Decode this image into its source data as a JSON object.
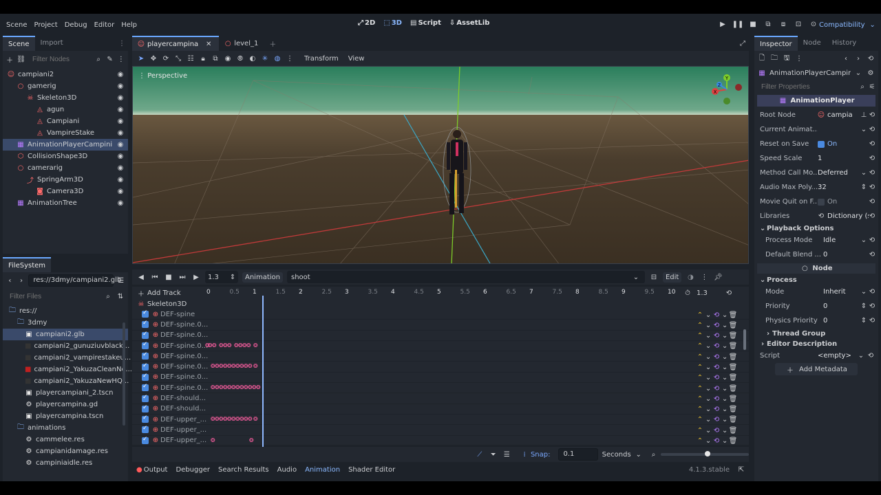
{
  "topbar": {
    "menus": [
      "Scene",
      "Project",
      "Debug",
      "Editor",
      "Help"
    ],
    "modes": [
      {
        "label": "2D",
        "active": false
      },
      {
        "label": "3D",
        "active": true
      },
      {
        "label": "Script",
        "active": false
      },
      {
        "label": "AssetLib",
        "active": false
      }
    ],
    "renderer": "Compatibility"
  },
  "scene_dock": {
    "tabs": [
      "Scene",
      "Import"
    ],
    "filter_placeholder": "Filter Nodes",
    "nodes": [
      {
        "label": "campiani2",
        "depth": 0,
        "icon": "person",
        "color": "#ff6a6a",
        "selected": false
      },
      {
        "label": "gamerig",
        "depth": 1,
        "icon": "circle",
        "color": "#ff6a6a",
        "selected": false
      },
      {
        "label": "Skeleton3D",
        "depth": 2,
        "icon": "bone",
        "color": "#ff6a6a",
        "selected": false
      },
      {
        "label": "agun",
        "depth": 3,
        "icon": "mesh",
        "color": "#ff6a6a",
        "selected": false
      },
      {
        "label": "Campiani",
        "depth": 3,
        "icon": "mesh",
        "color": "#ff6a6a",
        "selected": false
      },
      {
        "label": "VampireStake",
        "depth": 3,
        "icon": "mesh",
        "color": "#ff6a6a",
        "selected": false
      },
      {
        "label": "AnimationPlayerCampini",
        "depth": 1,
        "icon": "anim",
        "color": "#b77cff",
        "selected": true
      },
      {
        "label": "CollisionShape3D",
        "depth": 1,
        "icon": "shape",
        "color": "#ff6a6a",
        "selected": false
      },
      {
        "label": "camerarig",
        "depth": 1,
        "icon": "circle",
        "color": "#ff6a6a",
        "selected": false
      },
      {
        "label": "SpringArm3D",
        "depth": 2,
        "icon": "arm",
        "color": "#ff6a6a",
        "selected": false
      },
      {
        "label": "Camera3D",
        "depth": 3,
        "icon": "camera",
        "color": "#ff6a6a",
        "selected": false
      },
      {
        "label": "AnimationTree",
        "depth": 1,
        "icon": "anim",
        "color": "#b77cff",
        "selected": false
      }
    ]
  },
  "filesystem": {
    "title": "FileSystem",
    "path": "res://3dmy/campiani2.glb",
    "filter_placeholder": "Filter Files",
    "items": [
      {
        "label": "res://",
        "depth": 0,
        "kind": "folder",
        "selected": false
      },
      {
        "label": "3dmy",
        "depth": 1,
        "kind": "folder",
        "selected": false
      },
      {
        "label": "campiani2.glb",
        "depth": 2,
        "kind": "scene",
        "selected": true
      },
      {
        "label": "campiani2_gunuziuvblack...",
        "depth": 2,
        "kind": "image-dark",
        "selected": false
      },
      {
        "label": "campiani2_vampirestakeu...",
        "depth": 2,
        "kind": "image-dark",
        "selected": false
      },
      {
        "label": "campiani2_YakuzaCleanNo...",
        "depth": 2,
        "kind": "image-red",
        "selected": false
      },
      {
        "label": "campiani2_YakuzaNewHQ...",
        "depth": 2,
        "kind": "image-dark",
        "selected": false
      },
      {
        "label": "playercampiani_2.tscn",
        "depth": 2,
        "kind": "scene",
        "selected": false
      },
      {
        "label": "playercampina.gd",
        "depth": 2,
        "kind": "gear",
        "selected": false
      },
      {
        "label": "playercampina.tscn",
        "depth": 2,
        "kind": "scene",
        "selected": false
      },
      {
        "label": "animations",
        "depth": 1,
        "kind": "folder",
        "selected": false
      },
      {
        "label": "cammelee.res",
        "depth": 2,
        "kind": "res",
        "selected": false
      },
      {
        "label": "campianidamage.res",
        "depth": 2,
        "kind": "res",
        "selected": false
      },
      {
        "label": "campiniaidle.res",
        "depth": 2,
        "kind": "res",
        "selected": false
      }
    ]
  },
  "editor_tabs": [
    {
      "label": "playercampina",
      "active": true
    },
    {
      "label": "level_1",
      "active": false
    }
  ],
  "viewport": {
    "toolbar_menus": [
      "Transform",
      "View"
    ],
    "perspective_label": "Perspective",
    "gizmo": {
      "y": "Y",
      "x": "X",
      "z": "Z"
    }
  },
  "animation": {
    "time": "1.3",
    "label": "Animation",
    "current": "shoot",
    "edit_label": "Edit",
    "add_track": "Add Track",
    "timeline_end": "1.3",
    "ruler": [
      "0",
      "0.5",
      "1",
      "1.5",
      "2",
      "2.5",
      "3",
      "3.5",
      "4",
      "4.5",
      "5",
      "5.5",
      "6",
      "6.5",
      "7",
      "7.5",
      "8",
      "8.5",
      "9",
      "9.5",
      "10"
    ],
    "root": "Skeleton3D",
    "tracks": [
      {
        "name": "DEF-spine",
        "keys": []
      },
      {
        "name": "DEF-spine.0...",
        "keys": []
      },
      {
        "name": "DEF-spine.0...",
        "keys": []
      },
      {
        "name": "DEF-spine.0...",
        "keys": [
          0,
          2,
          5,
          10,
          13,
          16,
          21,
          24,
          27,
          30,
          35
        ]
      },
      {
        "name": "DEF-spine.0...",
        "keys": []
      },
      {
        "name": "DEF-spine.0...",
        "keys": [
          4,
          7,
          10,
          13,
          16,
          19,
          22,
          25,
          28,
          31,
          35
        ]
      },
      {
        "name": "DEF-spine.0...",
        "keys": []
      },
      {
        "name": "DEF-spine.0...",
        "keys": [
          4,
          7,
          10,
          13,
          16,
          19,
          22,
          25,
          28,
          31,
          34,
          37
        ]
      },
      {
        "name": "DEF-should...",
        "keys": []
      },
      {
        "name": "DEF-should...",
        "keys": []
      },
      {
        "name": "DEF-upper_...",
        "keys": [
          4,
          7,
          10,
          13,
          16,
          19,
          22,
          25,
          28,
          31,
          35
        ]
      },
      {
        "name": "DEF-upper_...",
        "keys": []
      },
      {
        "name": "DEF-upper_...",
        "keys": [
          4,
          32
        ]
      }
    ],
    "snap_label": "Snap:",
    "snap_value": "0.1",
    "snap_unit": "Seconds"
  },
  "bottom_panel": {
    "tabs": [
      "Output",
      "Debugger",
      "Search Results",
      "Audio",
      "Animation",
      "Shader Editor"
    ],
    "active": "Animation",
    "version": "4.1.3.stable"
  },
  "inspector": {
    "tabs": [
      "Inspector",
      "Node",
      "History"
    ],
    "object": "AnimationPlayerCampini",
    "filter_placeholder": "Filter Properties",
    "class_header": "AnimationPlayer",
    "props": [
      {
        "label": "Root Node",
        "value": "campia"
      },
      {
        "label": "Current Animat...",
        "value": ""
      },
      {
        "label": "Reset on Save",
        "value": "On",
        "check": true
      },
      {
        "label": "Speed Scale",
        "value": "1"
      },
      {
        "label": "Method Call Mo...",
        "value": "Deferred"
      },
      {
        "label": "Audio Max Poly...",
        "value": "32"
      },
      {
        "label": "Movie Quit on F...",
        "value": "On",
        "check": false
      },
      {
        "label": "Libraries",
        "value": "Dictionary (siz"
      }
    ],
    "playback_section": "Playback Options",
    "playback_props": [
      {
        "label": "Process Mode",
        "value": "Idle"
      },
      {
        "label": "Default Blend ...",
        "value": "0"
      }
    ],
    "node_section": "Node",
    "process_section": "Process",
    "process_props": [
      {
        "label": "Mode",
        "value": "Inherit"
      },
      {
        "label": "Priority",
        "value": "0"
      },
      {
        "label": "Physics Priority",
        "value": "0"
      }
    ],
    "thread_group": "Thread Group",
    "editor_description": "Editor Description",
    "script_label": "Script",
    "script_value": "<empty>",
    "add_metadata": "Add Metadata"
  }
}
